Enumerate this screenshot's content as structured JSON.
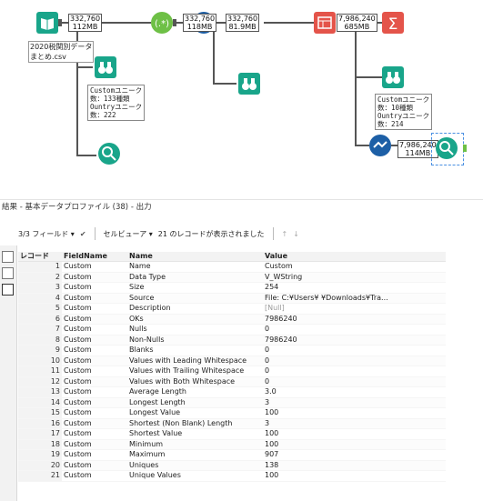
{
  "workflow": {
    "input_file_label": "2020税関別データ\nまとめ.csv",
    "badges": [
      {
        "records": "332,760",
        "size": "112MB"
      },
      {
        "records": "332,760",
        "size": "118MB"
      },
      {
        "records": "332,760",
        "size": "81.9MB"
      },
      {
        "records": "7,986,240",
        "size": "685MB"
      },
      {
        "records": "7,986,240",
        "size": "114MB"
      }
    ],
    "note1": "Customユニーク\n数：133種類\nOuntryユニーク\n数：222",
    "note2": "Customユニーク\n数：10種類\nOuntryユニーク\n数：214"
  },
  "results": {
    "header_title": "結果 - 基本データプロファイル (38) - 出力",
    "fields_dropdown": "3/3 フィールド",
    "cell_viewer": "セルビューア",
    "record_status": "21 のレコードが表示されました",
    "columns": [
      "レコード",
      "FieldName",
      "Name",
      "Value"
    ],
    "rows": [
      [
        "1",
        "Custom",
        "Name",
        "Custom"
      ],
      [
        "2",
        "Custom",
        "Data Type",
        "V_WString"
      ],
      [
        "3",
        "Custom",
        "Size",
        "254"
      ],
      [
        "4",
        "Custom",
        "Source",
        "File:  C:¥Users¥                ¥Downloads¥Tra..."
      ],
      [
        "5",
        "Custom",
        "Description",
        "[Null]"
      ],
      [
        "6",
        "Custom",
        "OKs",
        "7986240"
      ],
      [
        "7",
        "Custom",
        "Nulls",
        "0"
      ],
      [
        "8",
        "Custom",
        "Non-Nulls",
        "7986240"
      ],
      [
        "9",
        "Custom",
        "Blanks",
        "0"
      ],
      [
        "10",
        "Custom",
        "Values with Leading Whitespace",
        "0"
      ],
      [
        "11",
        "Custom",
        "Values with Trailing Whitespace",
        "0"
      ],
      [
        "12",
        "Custom",
        "Values with Both Whitespace",
        "0"
      ],
      [
        "13",
        "Custom",
        "Average Length",
        "3.0"
      ],
      [
        "14",
        "Custom",
        "Longest Length",
        "3"
      ],
      [
        "15",
        "Custom",
        "Longest Value",
        "100"
      ],
      [
        "16",
        "Custom",
        "Shortest (Non Blank) Length",
        "3"
      ],
      [
        "17",
        "Custom",
        "Shortest Value",
        "100"
      ],
      [
        "18",
        "Custom",
        "Minimum",
        "100"
      ],
      [
        "19",
        "Custom",
        "Maximum",
        "907"
      ],
      [
        "20",
        "Custom",
        "Uniques",
        "138"
      ],
      [
        "21",
        "Custom",
        "Unique Values",
        "100"
      ]
    ]
  },
  "icons": {
    "input": "book-icon",
    "formula": "formula-icon",
    "select": "select-icon",
    "browse": "binoculars-icon",
    "profile": "profile-icon",
    "transpose": "transpose-icon",
    "summarize": "sigma-icon",
    "join": "join-icon"
  }
}
